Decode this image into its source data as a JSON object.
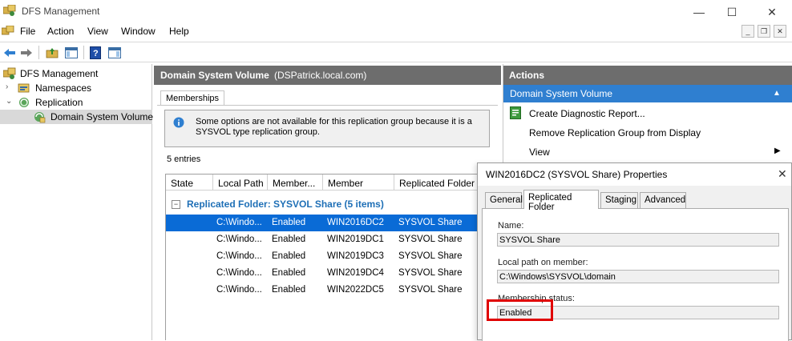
{
  "app": {
    "title": "DFS Management",
    "menu": [
      "File",
      "Action",
      "View",
      "Window",
      "Help"
    ]
  },
  "tree": {
    "items": [
      {
        "label": "DFS Management"
      },
      {
        "label": "Namespaces"
      },
      {
        "label": "Replication"
      },
      {
        "label": "Domain System Volume"
      }
    ]
  },
  "middle": {
    "header_title": "Domain System Volume",
    "header_sub": "(DSPatrick.local.com)",
    "tab_label": "Memberships",
    "info_text": "Some options are not available for this replication group because it is a SYSVOL type replication group.",
    "entries": "5 entries",
    "columns": [
      "State",
      "Local Path",
      "Member...",
      "Member",
      "Replicated Folder"
    ],
    "group_label": "Replicated Folder: SYSVOL Share (5 items)",
    "rows": [
      {
        "local_path": "C:\\Windo...",
        "status": "Enabled",
        "member": "WIN2016DC2",
        "folder": "SYSVOL Share"
      },
      {
        "local_path": "C:\\Windo...",
        "status": "Enabled",
        "member": "WIN2019DC1",
        "folder": "SYSVOL Share"
      },
      {
        "local_path": "C:\\Windo...",
        "status": "Enabled",
        "member": "WIN2019DC3",
        "folder": "SYSVOL Share"
      },
      {
        "local_path": "C:\\Windo...",
        "status": "Enabled",
        "member": "WIN2019DC4",
        "folder": "SYSVOL Share"
      },
      {
        "local_path": "C:\\Windo...",
        "status": "Enabled",
        "member": "WIN2022DC5",
        "folder": "SYSVOL Share"
      }
    ]
  },
  "actions": {
    "header": "Actions",
    "section": "Domain System Volume",
    "items": [
      {
        "label": "Create Diagnostic Report..."
      },
      {
        "label": "Remove Replication Group from Display"
      },
      {
        "label": "View"
      }
    ]
  },
  "dialog": {
    "title": "WIN2016DC2 (SYSVOL Share) Properties",
    "tabs": [
      "General",
      "Replicated Folder",
      "Staging",
      "Advanced"
    ],
    "name_label": "Name:",
    "name_value": "SYSVOL Share",
    "path_label": "Local path on member:",
    "path_value": "C:\\Windows\\SYSVOL\\domain",
    "status_label": "Membership status:",
    "status_value": "Enabled"
  },
  "colors": {
    "header_gray": "#6d6d6d",
    "selection_blue": "#0a6bd6",
    "group_blue": "#1e6fb6",
    "highlight_red": "#e00000"
  }
}
